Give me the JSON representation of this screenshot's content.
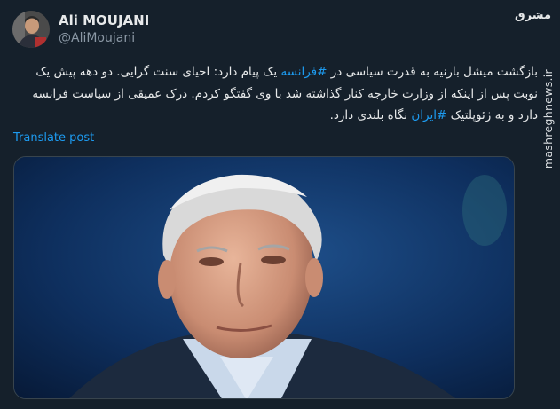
{
  "author": {
    "display_name": "Ali MOUJANI",
    "handle": "@AliMoujani"
  },
  "tweet": {
    "text_before_1": "بازگشت میشل بارنیه به قدرت سیاسی در ",
    "hashtag_1": "#فرانسه",
    "text_after_1": " یک پیام دارد: احیای سنت گرایی. دو دهه پیش یک نوبت پس از اینکه از وزارت خارجه کنار گذاشته شد با وی گفتگو کردم. درک عمیقی از سیاست فرانسه دارد و به ژئوپلتیک ",
    "hashtag_2": "#ایران",
    "text_after_2": " نگاه بلندی دارد."
  },
  "actions": {
    "translate_label": "Translate post"
  },
  "watermark": {
    "site": "mashreghnews.ir",
    "logo_text": "مشرق"
  },
  "colors": {
    "background": "#15202b",
    "link": "#1d9bf0",
    "text": "#e7e9ea",
    "muted": "#8b98a5"
  },
  "icons": [
    "avatar-photo",
    "media-photo"
  ]
}
